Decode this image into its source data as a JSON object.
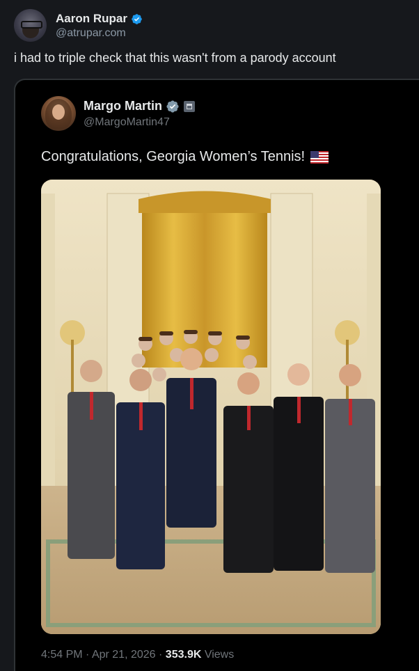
{
  "outer_tweet": {
    "author_name": "Aaron Rupar",
    "author_handle": "@atrupar.com",
    "text": "i had to triple check that this wasn't from a parody account",
    "verified_icon": "verified-badge-icon"
  },
  "quoted_tweet": {
    "author_name": "Margo Martin",
    "author_handle": "@MargoMartin47",
    "text": "Congratulations, Georgia Women’s Tennis!",
    "flag_icon": "us-flag-icon",
    "verified_icon": "verified-badge-icon",
    "affiliate_icon": "government-badge-icon",
    "time": "4:54 PM",
    "date": "Apr 21, 2026",
    "views_count": "353.9K",
    "views_label": "Views",
    "separator": "·"
  },
  "colors": {
    "background": "#16181c",
    "card": "#000000",
    "verified_blue": "#1d9bf0",
    "muted_text": "#71767b",
    "primary_text": "#e7e9ea"
  }
}
